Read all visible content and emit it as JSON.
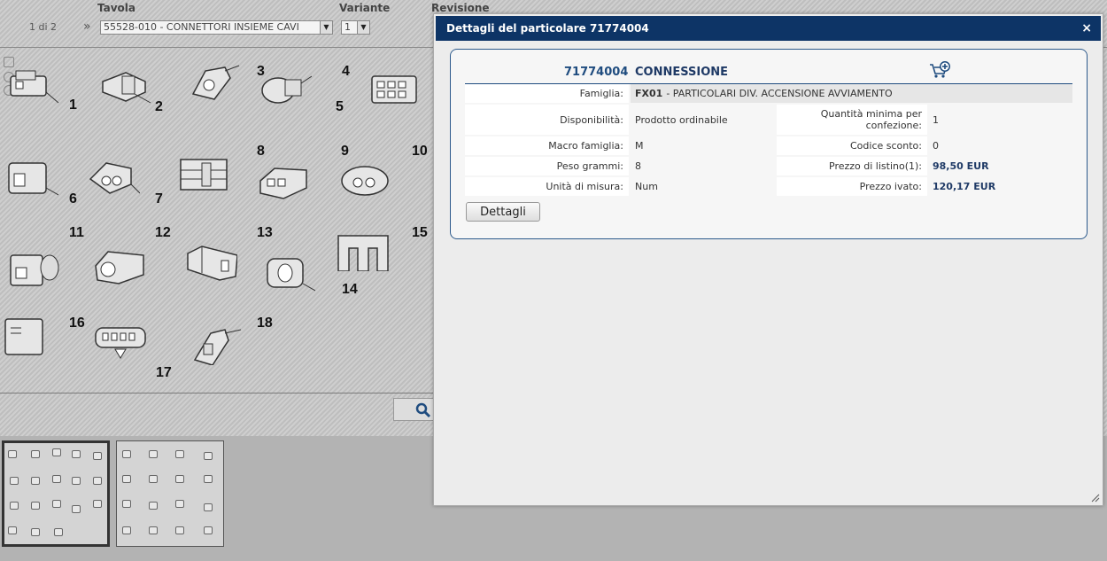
{
  "toolbar": {
    "tavola_label": "Tavola",
    "variante_label": "Variante",
    "revisione_label": "Revisione",
    "page_count": "1 di 2",
    "next_arrow": "»",
    "tavola_value": "55528-010 - CONNETTORI INSIEME CAVI",
    "variante_value": "1"
  },
  "drawing": {
    "part_numbers": [
      "1",
      "2",
      "3",
      "4",
      "5",
      "6",
      "7",
      "8",
      "9",
      "10",
      "11",
      "12",
      "13",
      "14",
      "15",
      "16",
      "17",
      "18"
    ]
  },
  "dialog": {
    "title": "Dettagli del particolare 71774004",
    "close_icon": "×",
    "part_code": "71774004",
    "part_name": "CONNESSIONE",
    "famiglia_label": "Famiglia:",
    "famiglia_code": "FX01",
    "famiglia_desc": "- PARTICOLARI DIV. ACCENSIONE AVVIAMENTO",
    "disponibilita_label": "Disponibilità:",
    "disponibilita_value": "Prodotto ordinabile",
    "quantita_label": "Quantità minima per confezione:",
    "quantita_value": "1",
    "macro_label": "Macro famiglia:",
    "macro_value": "M",
    "codice_sconto_label": "Codice sconto:",
    "codice_sconto_value": "0",
    "peso_label": "Peso grammi:",
    "peso_value": "8",
    "prezzo_listino_label": "Prezzo di listino(1):",
    "prezzo_listino_value": "98,50 EUR",
    "unita_label": "Unità di misura:",
    "unita_value": "Num",
    "prezzo_ivato_label": "Prezzo ivato:",
    "prezzo_ivato_value": "120,17 EUR",
    "dettagli_button": "Dettagli"
  },
  "colors": {
    "header_bg": "#0d3466",
    "accent": "#1f4c7f"
  },
  "icons": [
    "close-icon",
    "add-to-cart-icon",
    "search-icon",
    "zoom-in-icon",
    "zoom-out-icon",
    "resize-grip-icon"
  ]
}
